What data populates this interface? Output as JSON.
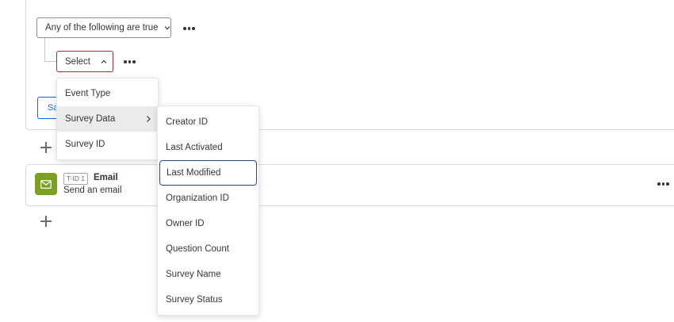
{
  "condition": {
    "any_dropdown_label": "Any of the following are true",
    "select_label": "Select",
    "save_label": "Sa"
  },
  "task": {
    "badge": "T-ID 1",
    "title": "Email",
    "subtitle": "Send an email"
  },
  "menu": {
    "items": [
      {
        "label": "Event Type"
      },
      {
        "label": "Survey Data"
      },
      {
        "label": "Survey ID"
      }
    ]
  },
  "submenu": {
    "items": [
      {
        "label": "Creator ID"
      },
      {
        "label": "Last Activated"
      },
      {
        "label": "Last Modified"
      },
      {
        "label": "Organization ID"
      },
      {
        "label": "Owner ID"
      },
      {
        "label": "Question Count"
      },
      {
        "label": "Survey Name"
      },
      {
        "label": "Survey Status"
      }
    ]
  },
  "colors": {
    "accent_blue": "#0b6ed0",
    "error_red": "#b32d2e",
    "email_green": "#7aa11f",
    "focus_navy": "#1b4f8a"
  },
  "icons": [
    "chevron-down-icon",
    "chevron-up-icon",
    "more-icon",
    "plus-icon",
    "email-icon",
    "chevron-right-icon"
  ]
}
